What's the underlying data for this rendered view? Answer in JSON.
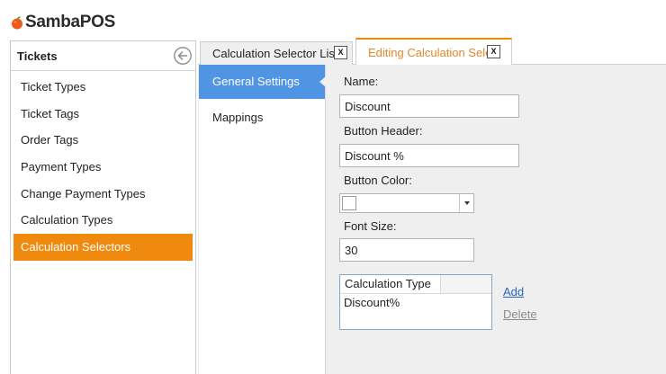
{
  "app": {
    "logo_text": "SambaPOS"
  },
  "sidebar": {
    "title": "Tickets",
    "items": [
      {
        "label": "Ticket Types"
      },
      {
        "label": "Ticket Tags"
      },
      {
        "label": "Order Tags"
      },
      {
        "label": "Payment Types"
      },
      {
        "label": "Change Payment Types"
      },
      {
        "label": "Calculation Types"
      },
      {
        "label": "Calculation Selectors",
        "active": true
      }
    ]
  },
  "tabs": [
    {
      "label": "Calculation Selector List",
      "close": "X",
      "active": false
    },
    {
      "label": "Editing Calculation Selector",
      "close": "X",
      "active": true
    }
  ],
  "settings_nav": {
    "items": [
      {
        "label": "General Settings",
        "active": true
      },
      {
        "label": "Mappings",
        "active": false
      }
    ]
  },
  "form": {
    "name_label": "Name:",
    "name_value": "Discount",
    "button_header_label": "Button Header:",
    "button_header_value": "Discount %",
    "button_color_label": "Button Color:",
    "button_color_value": "#ffffff",
    "font_size_label": "Font Size:",
    "font_size_value": "30"
  },
  "calculation_types": {
    "column_header": "Calculation Type",
    "rows": [
      "Discount%"
    ],
    "add_label": "Add",
    "delete_label": "Delete"
  },
  "colors": {
    "accent_orange": "#f08a0f",
    "nav_active_blue": "#4f95e3",
    "link_blue": "#2a63c9",
    "link_disabled": "#8d8d8d"
  }
}
